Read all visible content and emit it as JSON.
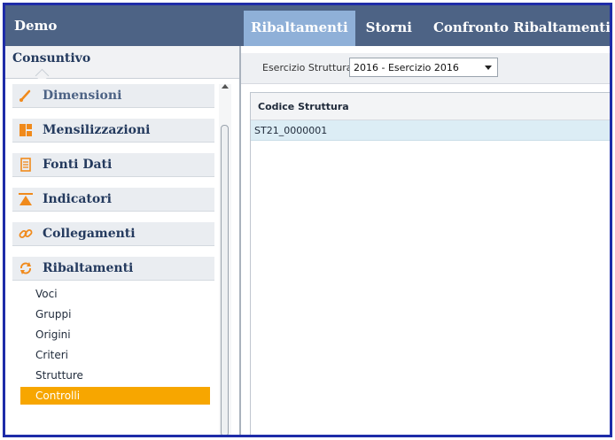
{
  "app": {
    "title": "Demo"
  },
  "tabs": [
    {
      "label": "Ribaltamenti",
      "active": true
    },
    {
      "label": "Storni",
      "active": false
    },
    {
      "label": "Confronto Ribaltamenti",
      "active": false
    }
  ],
  "sidebar": {
    "header": "Consuntivo",
    "items": [
      {
        "label": "Dimensioni",
        "icon": "pencil-icon"
      },
      {
        "label": "Mensilizzazioni",
        "icon": "layout-icon"
      },
      {
        "label": "Fonti Dati",
        "icon": "document-icon"
      },
      {
        "label": "Indicatori",
        "icon": "indicator-icon"
      },
      {
        "label": "Collegamenti",
        "icon": "link-icon"
      },
      {
        "label": "Ribaltamenti",
        "icon": "refresh-icon"
      }
    ],
    "subitems": [
      "Voci",
      "Gruppi",
      "Origini",
      "Criteri",
      "Strutture",
      "Controlli"
    ],
    "active_subitem": "Controlli"
  },
  "filter": {
    "label": "Esercizio Struttura:",
    "selected": "2016 - Esercizio 2016"
  },
  "grid": {
    "column": "Codice Struttura",
    "rows": [
      "ST21_0000001"
    ]
  },
  "colors": {
    "topbar": "#4d6385",
    "active_tab": "#8fb0d8",
    "icon_orange": "#f08a1c",
    "active_subitem": "#f7a600",
    "selected_row": "#dcedf5"
  }
}
